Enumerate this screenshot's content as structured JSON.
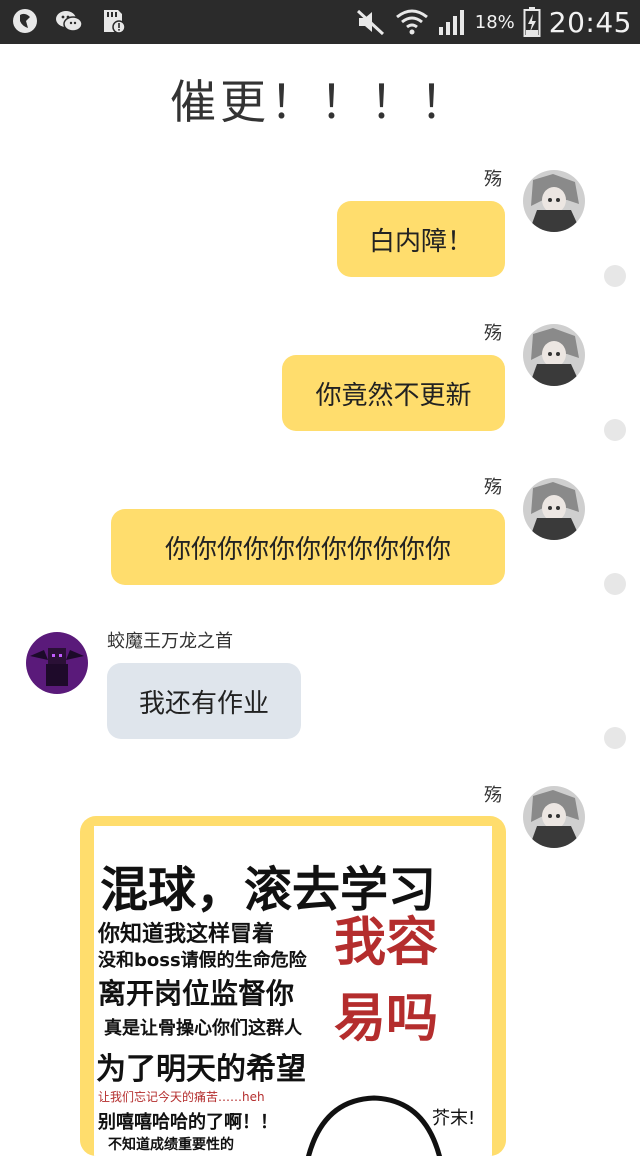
{
  "status_bar": {
    "icons_left": [
      "location-icon",
      "wechat-icon",
      "sd-card-icon"
    ],
    "icons_right": [
      "mute-icon",
      "wifi-icon",
      "signal-icon",
      "battery-icon"
    ],
    "battery_percent": "18%",
    "time": "20:45"
  },
  "chat": {
    "title": "催更！！！！",
    "messages": [
      {
        "sender": "殇",
        "text": "白内障！",
        "side": "right"
      },
      {
        "sender": "殇",
        "text": "你竟然不更新",
        "side": "right"
      },
      {
        "sender": "殇",
        "text": "你你你你你你你你你你你",
        "side": "right"
      },
      {
        "sender": "蛟魔王万龙之首",
        "text": "我还有作业",
        "side": "left"
      },
      {
        "sender": "殇",
        "type": "image",
        "side": "right"
      }
    ]
  },
  "meme": {
    "headline": "混球，滚去学习",
    "line1": "你知道我这样冒着",
    "line2": "没和boss请假的生命危险",
    "line3": "离开岗位监督你",
    "line4": "真是让骨操心你们这群人",
    "line5": "为了明天的希望",
    "line6": "让我们忘记今天的痛苦……heh",
    "line7": "别嘻嘻哈哈的了啊！！",
    "line8": "不知道成绩重要性的",
    "red1": "我容",
    "red2": "易吗",
    "signature": "芥末!"
  },
  "colors": {
    "status_bar_bg": "#2b2b2b",
    "bubble_self": "#ffdd6d",
    "bubble_other": "#dfe5ec",
    "meme_red": "#b42d2d"
  }
}
